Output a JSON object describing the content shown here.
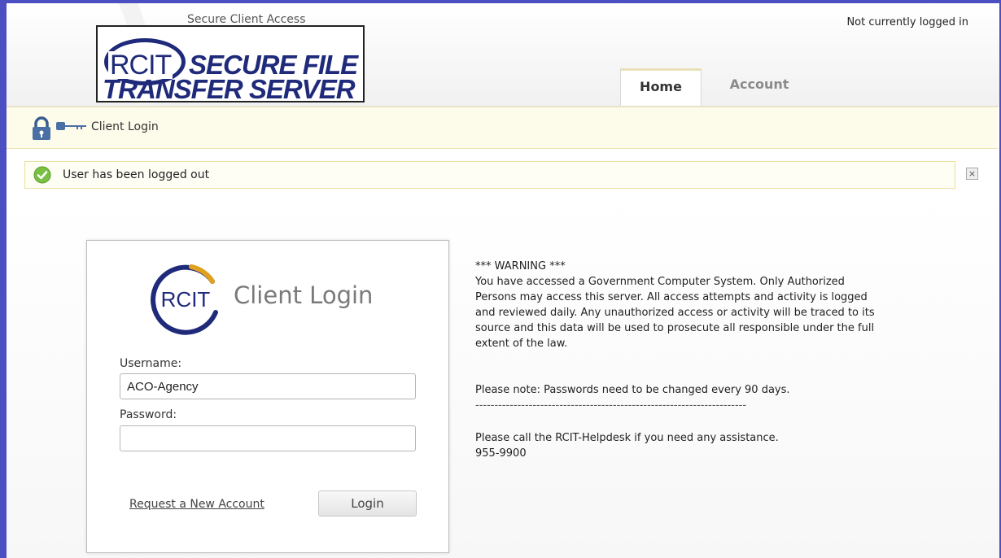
{
  "header": {
    "site_title": "Secure Client Access",
    "logo_text": {
      "rcit": "RCIT",
      "line1": "SECURE FILE",
      "line2": "TRANSFER SERVER"
    },
    "login_status": "Not currently logged in",
    "tabs": [
      {
        "label": "Home",
        "active": true
      },
      {
        "label": "Account",
        "active": false
      }
    ]
  },
  "subheader": {
    "title": "Client Login",
    "icons": [
      "lock-icon",
      "key-icon"
    ]
  },
  "notice": {
    "icon": "checkmark-icon",
    "text": "User has been logged out",
    "close_label": "×"
  },
  "login_form": {
    "logo_text": "RCIT",
    "heading": "Client Login",
    "username_label": "Username:",
    "username_value": "ACO-Agency",
    "password_label": "Password:",
    "password_value": "",
    "request_link": "Request a New Account",
    "login_button": "Login"
  },
  "warning": {
    "heading": "*** WARNING ***",
    "body": "You have accessed a Government Computer System. Only Authorized Persons may access this server. All access attempts and activity is logged and reviewed daily. Any unauthorized access or activity will be traced to its source and this data will be used to prosecute all responsible under the full extent of the law.",
    "password_note": "Please note: Passwords need to be changed every 90 days.",
    "divider": "-----------------------------------------------------------------------",
    "helpdesk": "Please call the RCIT-Helpdesk if you need any assistance.",
    "phone": "955-9900"
  },
  "colors": {
    "frame_border": "#4b4fc2",
    "logo_blue": "#1f2a7a",
    "subbar_bg": "#fdfbe9",
    "notice_border": "#eadf9f",
    "success_green": "#7ac043"
  }
}
